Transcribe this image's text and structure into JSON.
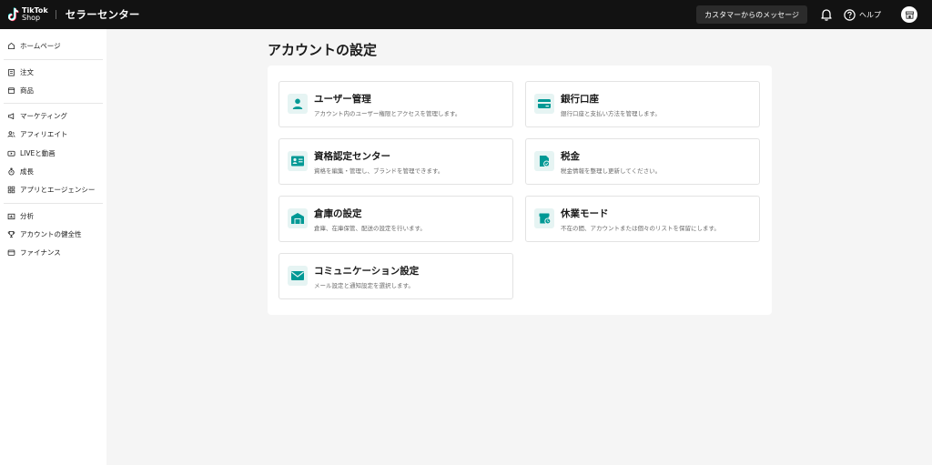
{
  "header": {
    "logo_line1": "TikTok",
    "logo_line2": "Shop",
    "app_title": "セラーセンター",
    "message_button": "カスタマーからのメッセージ",
    "help_label": "ヘルプ"
  },
  "sidebar": {
    "items": [
      {
        "label": "ホームページ",
        "icon": "home-icon"
      },
      {
        "label": "注文",
        "icon": "clipboard-icon"
      },
      {
        "label": "商品",
        "icon": "box-icon"
      },
      {
        "label": "マーケティング",
        "icon": "megaphone-icon"
      },
      {
        "label": "アフィリエイト",
        "icon": "users-icon"
      },
      {
        "label": "LIVEと動画",
        "icon": "video-icon"
      },
      {
        "label": "成長",
        "icon": "growth-icon"
      },
      {
        "label": "アプリとエージェンシー",
        "icon": "apps-icon"
      },
      {
        "label": "分析",
        "icon": "analytics-icon"
      },
      {
        "label": "アカウントの健全性",
        "icon": "trophy-icon"
      },
      {
        "label": "ファイナンス",
        "icon": "wallet-icon"
      }
    ]
  },
  "main": {
    "title": "アカウントの設定",
    "cards": [
      {
        "title": "ユーザー管理",
        "desc": "アカウント内のユーザー権限とアクセスを管理します。",
        "icon": "user-icon"
      },
      {
        "title": "銀行口座",
        "desc": "銀行口座と支払い方法を管理します。",
        "icon": "card-icon"
      },
      {
        "title": "資格認定センター",
        "desc": "資格を編集・管理し、ブランドを管理できます。",
        "icon": "id-card-icon"
      },
      {
        "title": "税金",
        "desc": "税金情報を整理し更新してください。",
        "icon": "tax-document-icon"
      },
      {
        "title": "倉庫の設定",
        "desc": "倉庫、在庫保管、配送の設定を行います。",
        "icon": "warehouse-icon"
      },
      {
        "title": "休業モード",
        "desc": "不在の間、アカウントまたは個々のリストを保留にします。",
        "icon": "store-clock-icon"
      },
      {
        "title": "コミュニケーション設定",
        "desc": "メール設定と通知設定を選択します。",
        "icon": "mail-icon"
      }
    ]
  },
  "colors": {
    "accent": "#009995",
    "header_bg": "#121212"
  }
}
